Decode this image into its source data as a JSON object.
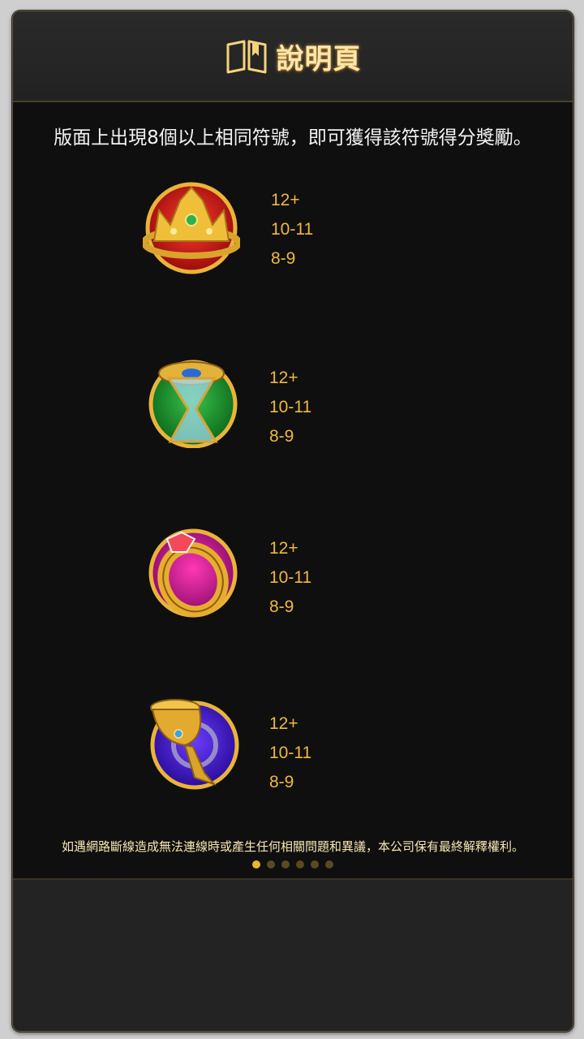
{
  "header": {
    "title": "說明頁",
    "icon": "book-icon"
  },
  "description": "版面上出現8個以上相同符號，即可獲得該符號得分獎勵。",
  "symbols": [
    {
      "name": "crown",
      "payouts": [
        "12+",
        "10-11",
        "8-9"
      ]
    },
    {
      "name": "hourglass",
      "payouts": [
        "12+",
        "10-11",
        "8-9"
      ]
    },
    {
      "name": "ring",
      "payouts": [
        "12+",
        "10-11",
        "8-9"
      ]
    },
    {
      "name": "chalice",
      "payouts": [
        "12+",
        "10-11",
        "8-9"
      ]
    }
  ],
  "footer_note": "如遇網路斷線造成無法連線時或產生任何相關問題和異議，本公司保有最終解釋權利。",
  "pagination": {
    "total": 6,
    "current": 1
  },
  "colors": {
    "accent_gold": "#f0b840",
    "title_gold": "#fbe6ad",
    "background": "#0f0f0f"
  }
}
